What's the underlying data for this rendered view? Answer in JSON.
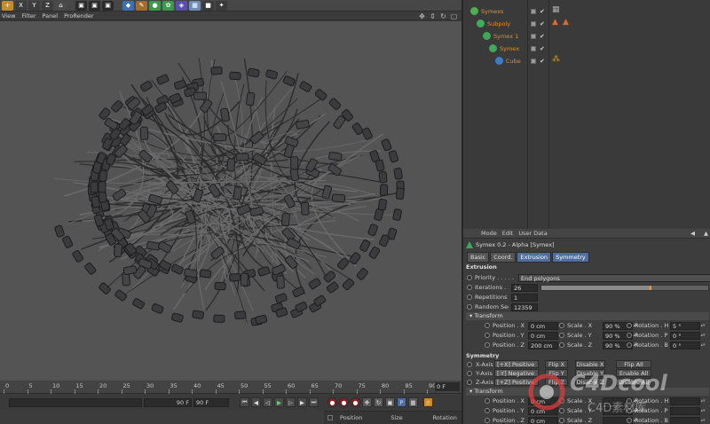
{
  "menubar": {
    "items": [
      "View",
      "Filter",
      "Panel",
      "ProRender"
    ]
  },
  "objects": [
    {
      "name": "Symexs",
      "icon_color": "#4caf50",
      "indent": 0,
      "tags": [
        "checker"
      ]
    },
    {
      "name": "Subpoly",
      "icon_color": "#3cae5b",
      "indent": 1,
      "tags": [
        "orange-triangle",
        "orange-triangle"
      ]
    },
    {
      "name": "Symex 1",
      "icon_color": "#3ea85a",
      "indent": 2,
      "tags": []
    },
    {
      "name": "Symex",
      "icon_color": "#3ea85a",
      "indent": 3,
      "tags": []
    },
    {
      "name": "Cube",
      "icon_color": "#3d7cc9",
      "indent": 4,
      "tags": [
        "orange-dots"
      ]
    }
  ],
  "attr": {
    "menu": [
      "Mode",
      "Edit",
      "User Data"
    ],
    "title": "Symex 0.2 - Alpha [Symex]",
    "tabs": [
      "Basic",
      "Coord.",
      "Extrusion",
      "Symmetry"
    ],
    "active_tabs": [
      "Extrusion",
      "Symmetry"
    ],
    "extrusion_heading": "Extrusion",
    "priority_label": "Priority . . . . . . .",
    "priority_value": "End polygons",
    "iterations_label": "Iterations . . . .",
    "iterations_value": "26",
    "iterations_fraction": 0.65,
    "repetitions_label": "Repetitions . . .",
    "repetitions_value": "1",
    "seed_label": "Random Seed",
    "seed_value": "12359",
    "transform_heading": "Transform",
    "transform1": [
      {
        "pos_label": "Position . X",
        "pos": "0 cm",
        "scale_label": "Scale . X",
        "scale": "90 %",
        "rot_label": "Rotation . H",
        "rot": "5 °"
      },
      {
        "pos_label": "Position . Y",
        "pos": "0 cm",
        "scale_label": "Scale . Y",
        "scale": "90 %",
        "rot_label": "Rotation . P",
        "rot": "0 °"
      },
      {
        "pos_label": "Position . Z",
        "pos": "200 cm",
        "scale_label": "Scale . Z",
        "scale": "90 %",
        "rot_label": "Rotation . B",
        "rot": "0 °"
      }
    ],
    "symmetry_heading": "Symmetry",
    "symmetry": [
      {
        "label": "X-Axis",
        "mode": "[+X] Positive",
        "flip": "Flip X",
        "disable": "Disable X",
        "all": "Flip All"
      },
      {
        "label": "Y-Axis",
        "mode": "[-Y] Negative",
        "flip": "Flip Y",
        "disable": "Disable Y",
        "all": "Enable All"
      },
      {
        "label": "Z-Axis",
        "mode": "[+Z] Positive",
        "flip": "Flip Z",
        "disable": "Disable Z",
        "all": "Disable All"
      }
    ],
    "transform2": [
      {
        "pos_label": "Position . X",
        "pos": "0 cm",
        "scale_label": "Scale . X",
        "scale": "",
        "rot_label": "Rotation . H",
        "rot": ""
      },
      {
        "pos_label": "Position . Y",
        "pos": "0 cm",
        "scale_label": "Scale . Y",
        "scale": "",
        "rot_label": "Rotation . P",
        "rot": ""
      },
      {
        "pos_label": "Position . Z",
        "pos": "0 cm",
        "scale_label": "Scale . Z",
        "scale": "",
        "rot_label": "Rotation . B",
        "rot": ""
      }
    ]
  },
  "timeline": {
    "ticks": [
      "0",
      "5",
      "10",
      "15",
      "20",
      "25",
      "30",
      "35",
      "40",
      "45",
      "50",
      "55",
      "60",
      "65",
      "70",
      "75",
      "80",
      "85",
      "90"
    ],
    "current_frame": "0 F",
    "end_frame": "90 F",
    "end_frame_2": "90 F"
  },
  "coord": {
    "position": "Position",
    "size": "Size",
    "rotation": "Rotation"
  },
  "watermark": {
    "text": "C4Dcool",
    "subtext": "C4D素材库"
  }
}
